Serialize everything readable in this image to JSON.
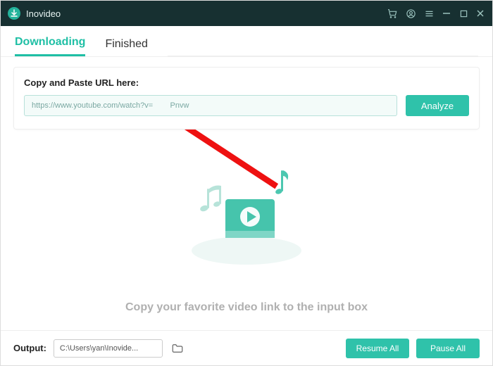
{
  "app": {
    "title": "Inovideo"
  },
  "tabs": {
    "downloading": "Downloading",
    "finished": "Finished",
    "active": "downloading"
  },
  "input_card": {
    "label": "Copy and Paste URL here:",
    "value": "https://www.youtube.com/watch?v=        Pnvw",
    "analyze": "Analyze"
  },
  "empty_hint": "Copy your favorite video link to the input box",
  "footer": {
    "output_label": "Output:",
    "output_path": "C:\\Users\\yan\\Inovide...",
    "resume_all": "Resume All",
    "pause_all": "Pause All"
  },
  "colors": {
    "accent": "#2fc2aa",
    "titlebar": "#173031"
  }
}
